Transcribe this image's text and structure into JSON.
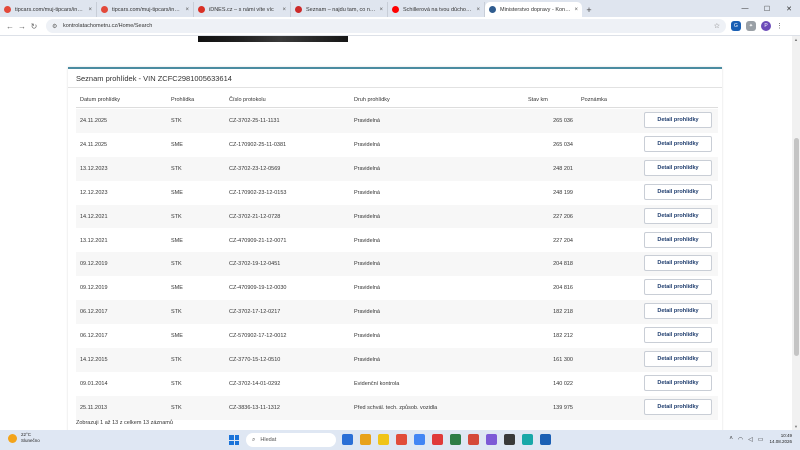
{
  "browser": {
    "tabs": [
      {
        "label": "tipcars.com/muj-tipcars/inzerat…",
        "color": "#e3493a",
        "active": false
      },
      {
        "label": "tipcars.com/muj-tipcars/inzerat…",
        "color": "#e3493a",
        "active": false
      },
      {
        "label": "iDNES.cz – s námi víte víc",
        "color": "#d93025",
        "active": false
      },
      {
        "label": "Seznam – najdu tam, co nezná…",
        "color": "#cc2a2a",
        "active": false
      },
      {
        "label": "Schillerová na tvou důchod…",
        "color": "#ff0000",
        "active": false
      },
      {
        "label": "Ministerstvo dopravy - Kontro…",
        "color": "#2f5c8f",
        "active": true
      }
    ],
    "url": "kontrolatachometru.cz/Home/Search"
  },
  "panel": {
    "title": "Seznam prohlídek - VIN ZCFC2981005633614",
    "columns": {
      "date": "Datum prohlídky",
      "type": "Prohlídka",
      "protocol": "Číslo protokolu",
      "kind": "Druh prohlídky",
      "km": "Stav km",
      "note": "Poznámka"
    },
    "detail_label": "Detail prohlídky",
    "rows": [
      {
        "date": "24.11.2025",
        "type": "STK",
        "protocol": "CZ-3702-25-11-1131",
        "kind": "Pravidelná",
        "km": "265 036"
      },
      {
        "date": "24.11.2025",
        "type": "SME",
        "protocol": "CZ-170902-25-11-0381",
        "kind": "Pravidelná",
        "km": "265 034"
      },
      {
        "date": "13.12.2023",
        "type": "STK",
        "protocol": "CZ-3702-23-12-0569",
        "kind": "Pravidelná",
        "km": "248 201"
      },
      {
        "date": "12.12.2023",
        "type": "SME",
        "protocol": "CZ-170902-23-12-0153",
        "kind": "Pravidelná",
        "km": "248 199"
      },
      {
        "date": "14.12.2021",
        "type": "STK",
        "protocol": "CZ-3702-21-12-0728",
        "kind": "Pravidelná",
        "km": "227 206"
      },
      {
        "date": "13.12.2021",
        "type": "SME",
        "protocol": "CZ-470909-21-12-0071",
        "kind": "Pravidelná",
        "km": "227 204"
      },
      {
        "date": "09.12.2019",
        "type": "STK",
        "protocol": "CZ-3702-19-12-0451",
        "kind": "Pravidelná",
        "km": "204 818"
      },
      {
        "date": "09.12.2019",
        "type": "SME",
        "protocol": "CZ-470909-19-12-0030",
        "kind": "Pravidelná",
        "km": "204 816"
      },
      {
        "date": "06.12.2017",
        "type": "STK",
        "protocol": "CZ-3702-17-12-0217",
        "kind": "Pravidelná",
        "km": "182 218"
      },
      {
        "date": "06.12.2017",
        "type": "SME",
        "protocol": "CZ-570902-17-12-0012",
        "kind": "Pravidelná",
        "km": "182 212"
      },
      {
        "date": "14.12.2015",
        "type": "STK",
        "protocol": "CZ-3770-15-12-0510",
        "kind": "Pravidelná",
        "km": "161 300"
      },
      {
        "date": "09.01.2014",
        "type": "STK",
        "protocol": "CZ-3702-14-01-0292",
        "kind": "Evidenční kontrola",
        "km": "140 022"
      },
      {
        "date": "25.11.2013",
        "type": "STK",
        "protocol": "CZ-3836-13-11-1312",
        "kind": "Před schvál. tech. způsob. vozidla",
        "km": "139 975"
      }
    ],
    "footer": "Zobrazuji 1 až 13 z celkem 13 záznamů"
  },
  "taskbar": {
    "temp": "22°C",
    "weather": "Slunečno",
    "search_placeholder": "Hledat",
    "time": "10:49",
    "date": "14.08.2026",
    "icon_colors": [
      "#2b6fd6",
      "#e8a21b",
      "#f0c419",
      "#e14c3a",
      "#4285f4",
      "#e03a3a",
      "#2d7d46",
      "#d54a3a",
      "#7d5ad6",
      "#3a3a3a",
      "#18a8a8",
      "#1a5fb4"
    ]
  }
}
